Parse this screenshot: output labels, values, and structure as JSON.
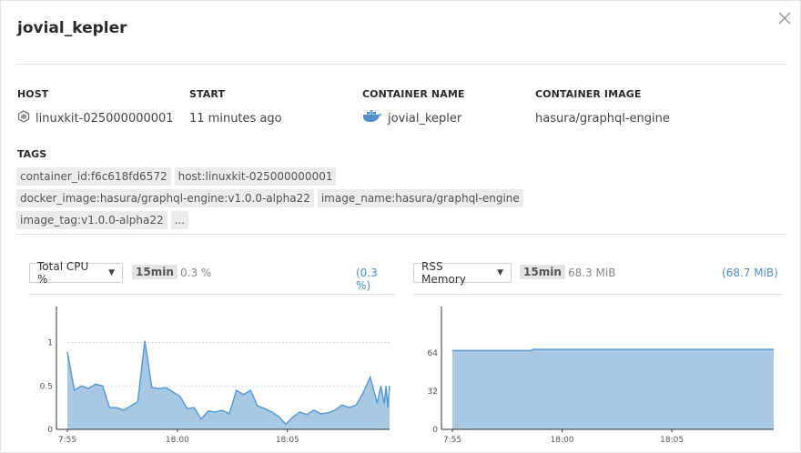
{
  "header": {
    "title": "jovial_kepler"
  },
  "meta": {
    "host_label": "HOST",
    "host_value": "linuxkit-025000000001",
    "start_label": "START",
    "start_value": "11 minutes ago",
    "container_name_label": "CONTAINER NAME",
    "container_name_value": "jovial_kepler",
    "container_image_label": "CONTAINER IMAGE",
    "container_image_value": "hasura/graphql-engine"
  },
  "tags": {
    "label": "TAGS",
    "items": [
      "container_id:f6c618fd6572",
      "host:linuxkit-025000000001",
      "docker_image:hasura/graphql-engine:v1.0.0-alpha22",
      "image_name:hasura/graphql-engine",
      "image_tag:v1.0.0-alpha22",
      "..."
    ]
  },
  "cpu": {
    "metric": "Total CPU %",
    "range": "15min",
    "current": "0.3 %",
    "average": "(0.3 %)"
  },
  "mem": {
    "metric": "RSS Memory",
    "range": "15min",
    "current": "68.3 MiB",
    "average": "(68.7 MiB)"
  },
  "colors": {
    "fill": "#a9c8e4",
    "line": "#5b9bd5",
    "link": "#4a90c8"
  },
  "chart_data": [
    {
      "type": "area",
      "title": "Total CPU %",
      "x_ticks": [
        "7:55",
        "18:00",
        "18:05"
      ],
      "y_ticks": [
        "0",
        "0.5",
        "1"
      ],
      "ylim": [
        0,
        1.1
      ],
      "x_minutes": [
        0,
        0.4,
        0.8,
        1.2,
        1.6,
        2.0,
        2.4,
        2.8,
        3.2,
        3.6,
        4.0,
        4.4,
        4.8,
        5.2,
        5.6,
        6.0,
        6.4,
        6.8,
        7.2,
        7.6,
        8.0,
        8.4,
        8.8,
        9.2,
        9.6,
        10.0,
        10.4,
        10.8,
        11.2,
        11.6,
        12.0,
        12.4,
        12.8,
        13.2,
        13.6,
        14.0,
        14.4,
        14.8,
        15.2,
        15.6,
        16.0,
        16.4,
        16.8,
        17.2,
        17.6,
        17.8,
        18.0,
        18.1,
        18.2,
        18.3
      ],
      "values": [
        0.89,
        0.45,
        0.5,
        0.47,
        0.52,
        0.5,
        0.25,
        0.25,
        0.22,
        0.27,
        0.32,
        1.02,
        0.48,
        0.47,
        0.48,
        0.43,
        0.38,
        0.24,
        0.25,
        0.12,
        0.21,
        0.2,
        0.22,
        0.18,
        0.45,
        0.4,
        0.45,
        0.27,
        0.24,
        0.2,
        0.15,
        0.06,
        0.14,
        0.2,
        0.17,
        0.22,
        0.18,
        0.19,
        0.22,
        0.28,
        0.25,
        0.28,
        0.42,
        0.6,
        0.3,
        0.5,
        0.3,
        0.5,
        0.25,
        0.5
      ]
    },
    {
      "type": "area",
      "title": "RSS Memory",
      "x_ticks": [
        "7:55",
        "18:00",
        "18:05"
      ],
      "y_ticks": [
        "0",
        "32",
        "64"
      ],
      "ylim": [
        0,
        80
      ],
      "x_minutes": [
        0,
        4.5,
        4.6,
        18.3
      ],
      "values": [
        66,
        66,
        67,
        67
      ]
    }
  ]
}
